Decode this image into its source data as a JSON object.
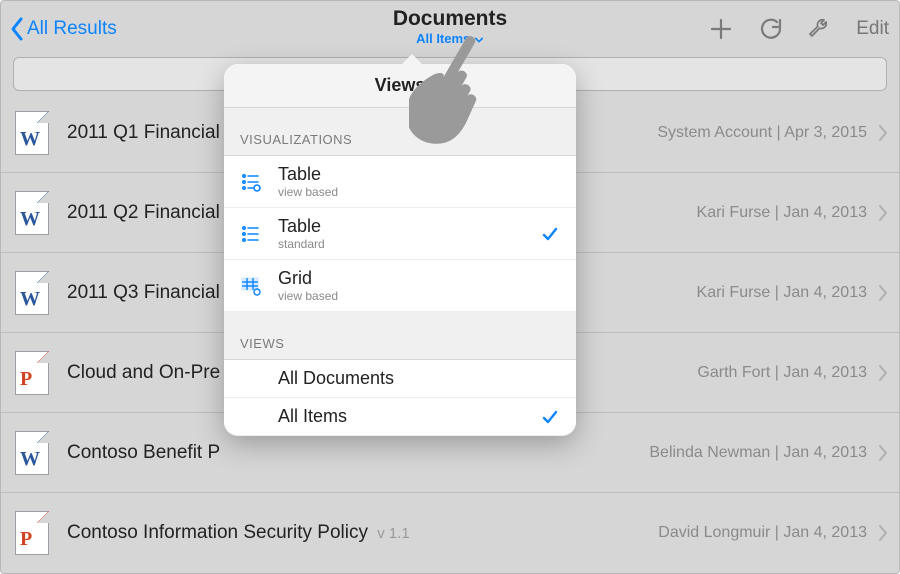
{
  "nav": {
    "back_label": "All Results",
    "title": "Documents",
    "subtitle": "All Items",
    "edit_label": "Edit"
  },
  "popover": {
    "title": "Views",
    "section_visualizations": "VISUALIZATIONS",
    "section_views": "VIEWS",
    "viz": [
      {
        "title": "Table",
        "subtitle": "view based",
        "selected": false
      },
      {
        "title": "Table",
        "subtitle": "standard",
        "selected": true
      },
      {
        "title": "Grid",
        "subtitle": "view based",
        "selected": false
      }
    ],
    "views": [
      {
        "title": "All Documents",
        "selected": false
      },
      {
        "title": "All Items",
        "selected": true
      }
    ]
  },
  "rows": [
    {
      "type": "word",
      "name": "2011 Q1 Financial",
      "version": "",
      "author": "System Account",
      "date": "Apr 3, 2015"
    },
    {
      "type": "word",
      "name": "2011 Q2 Financial",
      "version": "",
      "author": "Kari Furse",
      "date": "Jan 4, 2013"
    },
    {
      "type": "word",
      "name": "2011 Q3 Financial",
      "version": "",
      "author": "Kari Furse",
      "date": "Jan 4, 2013"
    },
    {
      "type": "ppt",
      "name": "Cloud and On-Pre",
      "version": "",
      "author": "Garth Fort",
      "date": "Jan 4, 2013"
    },
    {
      "type": "word",
      "name": "Contoso Benefit P",
      "version": "",
      "author": "Belinda Newman",
      "date": "Jan 4, 2013"
    },
    {
      "type": "ppt",
      "name": "Contoso Information Security Policy",
      "version": "v 1.1",
      "author": "David Longmuir",
      "date": "Jan 4, 2013"
    }
  ]
}
